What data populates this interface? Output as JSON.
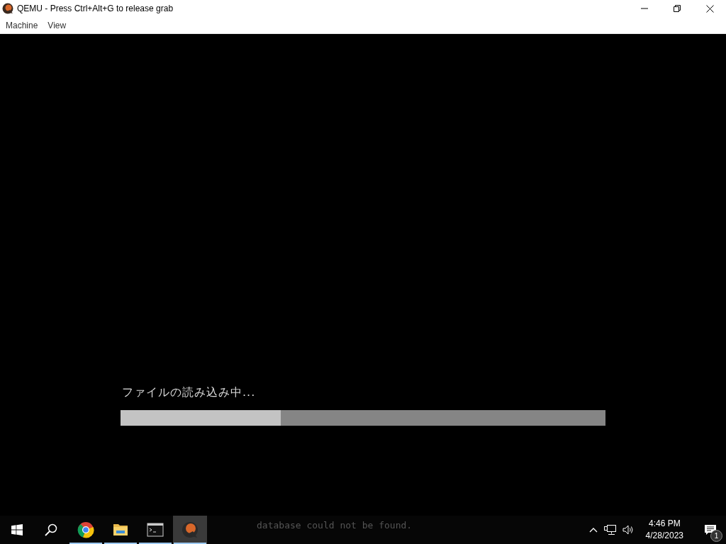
{
  "window": {
    "title": "QEMU - Press Ctrl+Alt+G to release grab"
  },
  "menu": [
    {
      "label": "Machine"
    },
    {
      "label": "View"
    }
  ],
  "screen": {
    "message": "ファイルの読み込み中...",
    "progress": {
      "level": 0.33
    },
    "console_text": "database could not be found."
  },
  "taskbar": {
    "apps": [
      {
        "kind": "chrome",
        "running": true,
        "selected": false
      },
      {
        "kind": "folder",
        "running": true,
        "selected": false
      },
      {
        "kind": "terminal",
        "running": true,
        "selected": false
      },
      {
        "kind": "qemu",
        "running": true,
        "selected": true
      }
    ],
    "time": "4:46 PM",
    "date": "4/28/2023",
    "notifications": "1"
  }
}
